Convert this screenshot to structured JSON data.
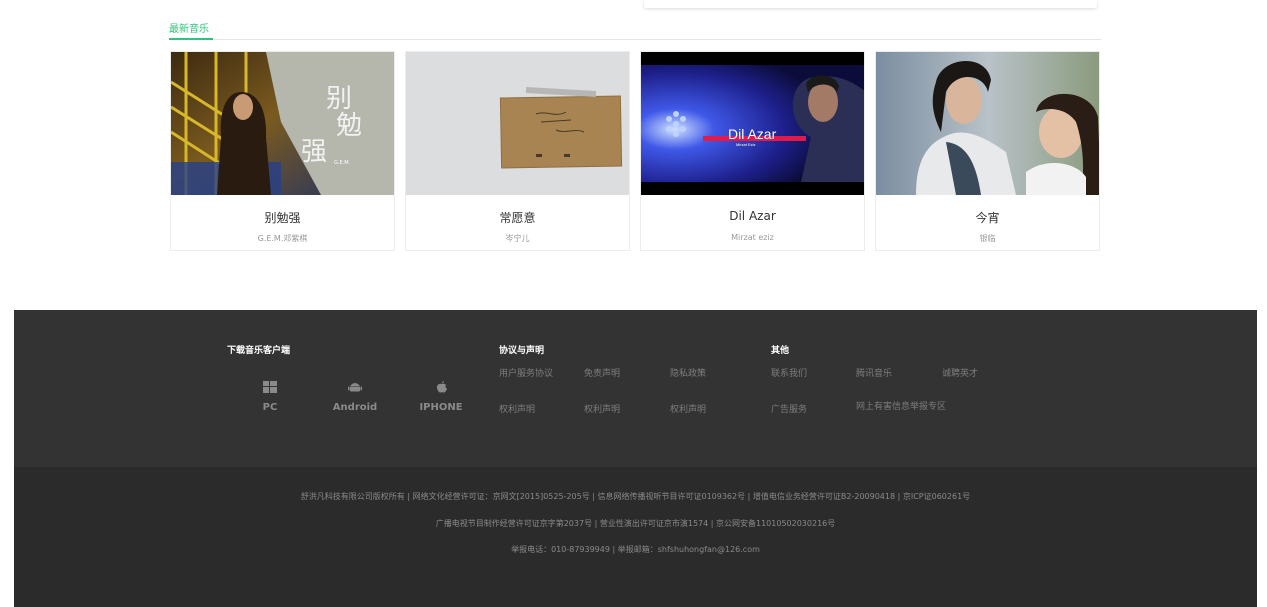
{
  "section": {
    "title": "最新音乐"
  },
  "songs": [
    {
      "title": "别勉强",
      "artist": "G.E.M.邓紫棋",
      "cover_text": "别勉强"
    },
    {
      "title": "常愿意",
      "artist": "岑宁儿"
    },
    {
      "title": "Dil Azar",
      "artist": "Mirzat eziz",
      "cover_text": "Dil Azar"
    },
    {
      "title": "今宵",
      "artist": "银临"
    }
  ],
  "footer": {
    "download": {
      "heading": "下载音乐客户端",
      "items": [
        {
          "label": "PC",
          "icon": "windows-icon"
        },
        {
          "label": "Android",
          "icon": "android-icon"
        },
        {
          "label": "IPHONE",
          "icon": "apple-icon"
        }
      ]
    },
    "agreement": {
      "heading": "协议与声明",
      "row1": [
        "用户服务协议",
        "免责声明",
        "隐私政策"
      ],
      "row2": [
        "权利声明",
        "权利声明",
        "权利声明"
      ]
    },
    "other": {
      "heading": "其他",
      "row1": [
        "联系我们",
        "腾讯音乐",
        "诚聘英才"
      ],
      "row2": [
        "广告服务",
        "网上有害信息举报专区"
      ]
    },
    "copyright": [
      "舒洪凡科技有限公司版权所有 | 网络文化经营许可证：京网文[2015]0525-205号 | 信息网络传播视听节目许可证0109362号 | 增值电信业务经营许可证B2-20090418 | 京ICP证060261号",
      "广播电视节目制作经营许可证京字第2037号 | 营业性演出许可证京市演1574 | 京公网安备11010502030216号",
      "举报电话：010-87939949 | 举报邮箱：shfshuhongfan@126.com"
    ]
  },
  "colors": {
    "accent": "#31c27c",
    "footer_bg": "#333333",
    "footer_bottom_bg": "#2b2b2b"
  }
}
